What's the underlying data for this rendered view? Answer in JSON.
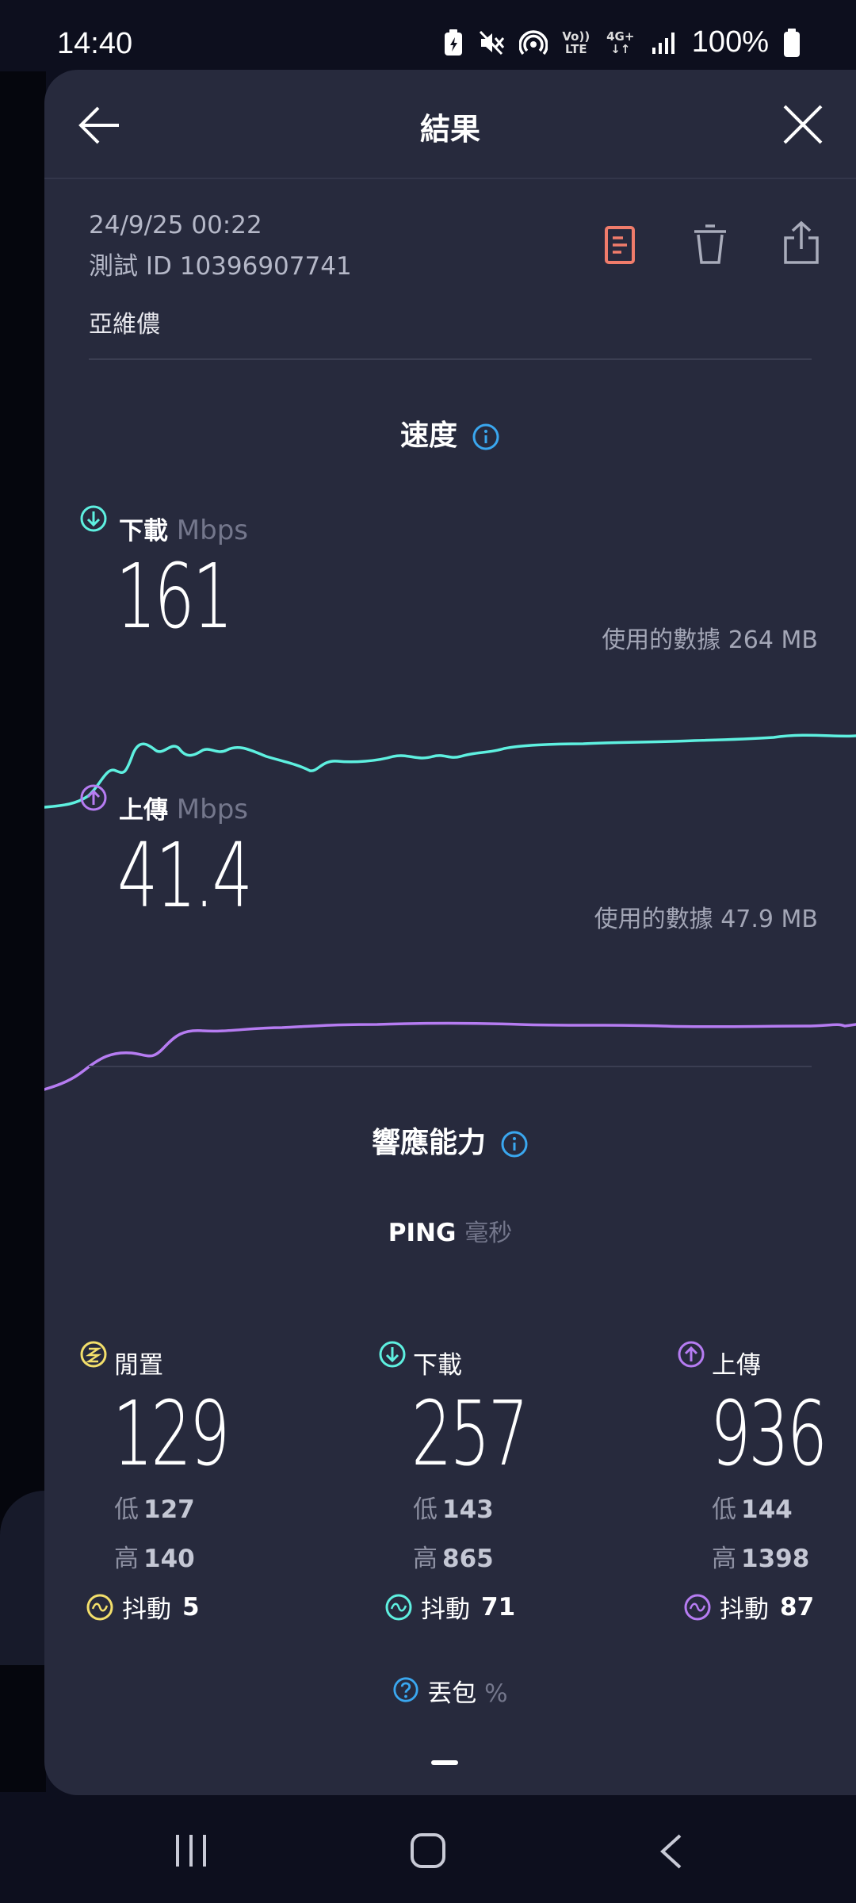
{
  "status_bar": {
    "time": "14:40",
    "battery_percent": "100%",
    "volte_label": "Vo)) LTE",
    "network_label": "4G+"
  },
  "header": {
    "title": "結果",
    "back_icon": "arrow-left-icon",
    "close_icon": "close-icon"
  },
  "meta": {
    "datetime": "24/9/25 00:22",
    "test_id": "測試 ID 10396907741",
    "isp": "亞維儂"
  },
  "speed": {
    "section_title": "速度",
    "download": {
      "label": "下載",
      "unit": "Mbps",
      "value": "161",
      "data_used": "使用的數據 264 MB",
      "color": "#5ef0e0"
    },
    "upload": {
      "label": "上傳",
      "unit": "Mbps",
      "value": "41.4",
      "data_used": "使用的數據 47.9 MB",
      "color": "#b67cf2"
    }
  },
  "responsiveness": {
    "section_title": "響應能力",
    "ping_label": "PING",
    "ping_unit": "毫秒",
    "low_label": "低",
    "high_label": "高",
    "jitter_label": "抖動",
    "columns": [
      {
        "label": "閒置",
        "value": "129",
        "low": "127",
        "high": "140",
        "jitter": "5",
        "color": "#f3df6b"
      },
      {
        "label": "下載",
        "value": "257",
        "low": "143",
        "high": "865",
        "jitter": "71",
        "color": "#5ef0e0"
      },
      {
        "label": "上傳",
        "value": "936",
        "low": "144",
        "high": "1398",
        "jitter": "87",
        "color": "#b67cf2"
      }
    ],
    "packet_loss": {
      "label": "丟包",
      "unit": "%"
    }
  },
  "colors": {
    "accent_info": "#3aa7ef",
    "accent_result_icon": "#f07c6b",
    "card_bg": "#272a3d"
  }
}
